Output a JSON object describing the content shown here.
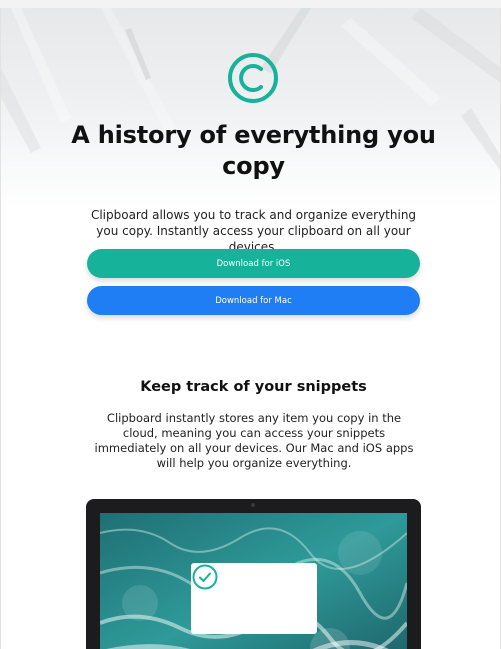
{
  "hero": {
    "logo_icon": "copyright-icon",
    "title": "A history of everything you copy",
    "description": "Clipboard allows you to track and organize everything you copy. Instantly access your clipboard on all your devices.",
    "buttons": {
      "ios_label": "Download for iOS",
      "mac_label": "Download for Mac"
    }
  },
  "features": {
    "title": "Keep track of your snippets",
    "description": "Clipboard instantly stores any item you copy in the cloud, meaning you can access your snippets immediately on all your devices. Our Mac and iOS apps will help you organize everything."
  },
  "device_preview": {
    "card_icon": "check-circle-icon"
  },
  "colors": {
    "accent": "#16b39a",
    "mac_button": "#1f7ef4",
    "device_frame": "#1c1c1e"
  }
}
